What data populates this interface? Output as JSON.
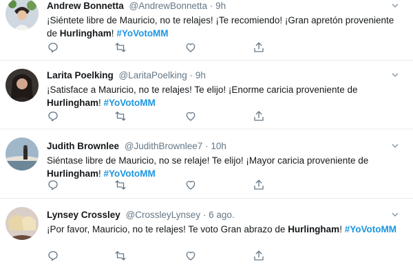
{
  "tweets": [
    {
      "name": "Andrew Bonnetta",
      "handle": "@AndrewBonnetta",
      "time": "9h",
      "text_parts": [
        "¡Siéntete libre de Mauricio, no te relajes! ¡Te recomiendo! ¡Gran apretón proveniente de ",
        "Hurlingham",
        "! ",
        "#YoVotoMM"
      ]
    },
    {
      "name": "Larita Poelking",
      "handle": "@LaritaPoelking",
      "time": "9h",
      "text_parts": [
        "¡Satisface a Mauricio, no te relajes! Te elijo! ¡Enorme caricia proveniente de ",
        "Hurlingham",
        "! ",
        "#YoVotoMM"
      ]
    },
    {
      "name": "Judith Brownlee",
      "handle": "@JudithBrownlee7",
      "time": "10h",
      "text_parts": [
        "Siéntase libre de Mauricio, no se relaje! Te elijo! ¡Mayor caricia proveniente de ",
        "Hurlingham",
        "! ",
        "#YoVotoMM"
      ]
    },
    {
      "name": "Lynsey Crossley",
      "handle": "@CrossleyLynsey",
      "time": "6 ago.",
      "text_parts": [
        "¡Por favor, Mauricio, no te relajes! Te voto Gran abrazo de ",
        "Hurlingham",
        "! ",
        "#YoVotoMM"
      ]
    }
  ],
  "separator": "·",
  "icons": {
    "more": "chevron-down-icon",
    "reply": "reply-icon",
    "retweet": "retweet-icon",
    "like": "heart-icon",
    "share": "share-icon"
  },
  "colors": {
    "hashtag": "#1b95e0",
    "meta": "#657786",
    "divider": "#e6ecf0"
  }
}
